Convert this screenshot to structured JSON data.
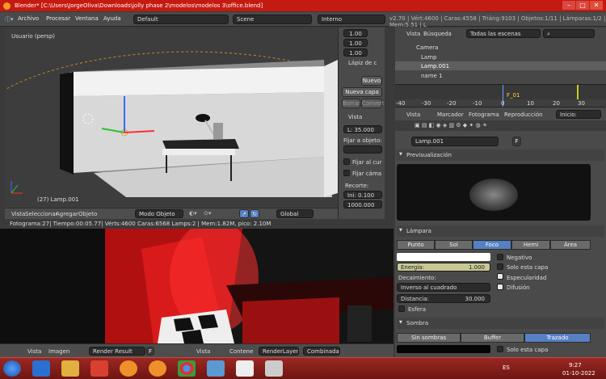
{
  "window": {
    "title": "Blender* [C:\\Users\\JorgeOliva\\Downloads\\jolly phase 2\\modelos\\modelos 3\\office.blend]"
  },
  "menu": {
    "items": [
      "Archivo",
      "Procesar",
      "Ventana",
      "Ayuda"
    ],
    "layout": "Default",
    "scene": "Scene",
    "engine": "Interno",
    "stats": "v2.70 | Vért:4600 | Caras:4558 | Triáng:9103 | Objetos:1/11 | Lámparas:1/2 | Mem:5.51 | L"
  },
  "viewport": {
    "label": "Usuario (persp)",
    "object_label": "(27) Lamp.001",
    "header": {
      "view": "Vista",
      "select": "Seleccionar",
      "add": "Agregar",
      "object": "Objeto",
      "mode": "Modo Objeto",
      "orientation": "Global"
    }
  },
  "tool": {
    "fields": [
      "1.00",
      "1.00",
      "1.00"
    ],
    "grease_title": "Lápiz de c",
    "new_btn": "Nuevo",
    "new_layer": "Nueva capa",
    "erase": "Borrar",
    "convert": "Convert",
    "view_title": "Vista",
    "lens": "L: 35.000",
    "lock_to_obj": "Fijar a objeto:",
    "lock_cursor": "Fijar al cur",
    "lock_camera": "Fijar cáma",
    "clip_title": "Recorte:",
    "clip_start": "Ini: 0.100",
    "clip_end": "1000.000"
  },
  "outliner": {
    "tabs": {
      "view": "Vista",
      "search": "Búsqueda",
      "filter": "Todas las escenas"
    },
    "items": [
      {
        "name": "Camera"
      },
      {
        "name": "Lamp"
      },
      {
        "name": "Lamp.001"
      },
      {
        "name": "name 1"
      }
    ]
  },
  "timeline": {
    "ticks": [
      "-40",
      "-30",
      "-20",
      "-10",
      "0",
      "10",
      "20",
      "30"
    ],
    "marker": "F_01"
  },
  "props": {
    "header": {
      "view": "Vista",
      "marker": "Marcador",
      "frame": "Fotograma",
      "playback": "Reproducción",
      "start": "Inicio:"
    },
    "lamp_name": "Lamp.001",
    "lamp_name_flag": "F",
    "preview_title": "Previsualización",
    "lamp_panel": "Lámpara",
    "types": [
      "Punto",
      "Sol",
      "Foco",
      "Hemi",
      "Área"
    ],
    "selected_type": "Foco",
    "negative": "Negativo",
    "this_layer": "Solo esta capa",
    "energy": "Energía:",
    "energy_value": "1.000",
    "specular": "Especularidad",
    "falloff": "Decaimiento:",
    "falloff_value": "Inverso al cuadrado",
    "diffuse": "Difusión",
    "distance": "Distancia:",
    "distance_value": "30.000",
    "sphere": "Esfera",
    "shadow_panel": "Sombra",
    "shadow_types": [
      "Sin sombras",
      "Buffer",
      "Trazado"
    ],
    "shadow_selected": "Trazado",
    "shadow_layer": "Solo esta capa"
  },
  "render": {
    "info": "Fotograma:27| Tiempo:00:05.77| Vérts:4600 Caras:6568 Lamps:2 | Mem:1.82M, pico: 2.10M",
    "header": {
      "view": "Vista",
      "image": "Imagen",
      "result": "Render Result",
      "flag": "F",
      "view2": "Vista",
      "content": "Contene",
      "layer": "RenderLayer",
      "combined": "Combinada"
    }
  },
  "taskbar": {
    "lang": "ES",
    "time": "9:27",
    "date": "01-10-2022"
  },
  "colors": {
    "title_red": "#c51a10",
    "accent_blue": "#5680c2",
    "render_red": "#cc1111"
  }
}
